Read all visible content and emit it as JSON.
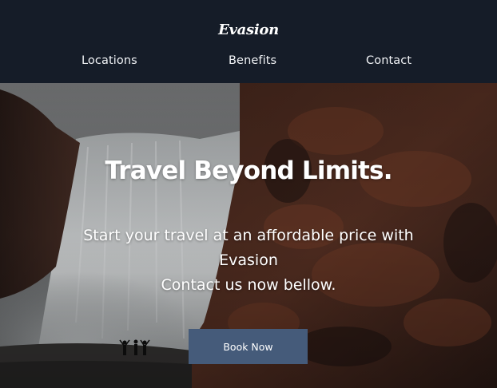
{
  "header": {
    "logo": "Evasion",
    "nav": [
      {
        "label": "Locations"
      },
      {
        "label": "Benefits"
      },
      {
        "label": "Contact"
      }
    ]
  },
  "hero": {
    "title": "Travel Beyond Limits.",
    "subtitle_lines": [
      "Start your travel at an affordable price with",
      "Evasion",
      "Contact us now bellow."
    ],
    "cta_label": "Book Now"
  },
  "colors": {
    "header_bg": "#151c28",
    "button_bg": "#455b7a",
    "text": "#ffffff"
  }
}
